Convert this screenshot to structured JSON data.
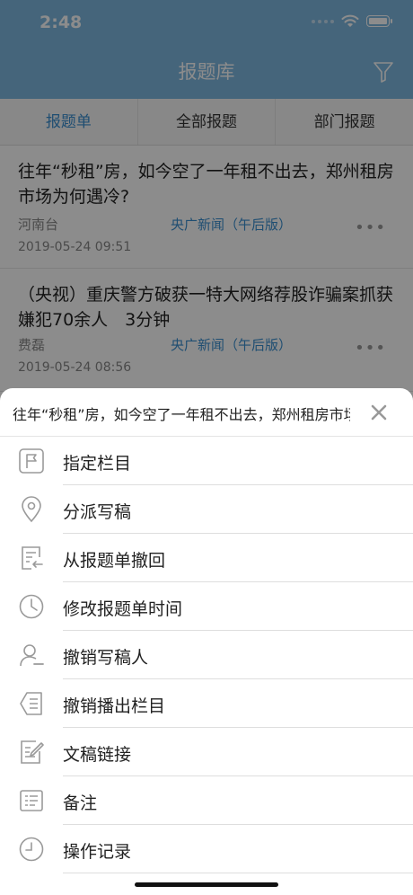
{
  "status_bar": {
    "time": "2:48"
  },
  "nav": {
    "title": "报题库"
  },
  "tabs": [
    {
      "label": "报题单",
      "active": true
    },
    {
      "label": "全部报题",
      "active": false
    },
    {
      "label": "部门报题",
      "active": false
    }
  ],
  "news": [
    {
      "title": "往年“秒租”房，如今空了一年租不出去，郑州租房市场为何遇冷?",
      "author": "河南台",
      "source": "央广新闻（午后版）",
      "date": "2019-05-24 09:51",
      "more": "•••"
    },
    {
      "title": "（央视）重庆警方破获一特大网络荐股诈骗案抓获嫌犯70余人　3分钟",
      "author": "费磊",
      "source": "央广新闻（午后版）",
      "date": "2019-05-24 08:56",
      "more": "•••"
    }
  ],
  "sheet": {
    "title": "往年“秒租”房，如今空了一年租不出去，郑州租房市场为何遇冷?",
    "items": [
      {
        "label": "指定栏目",
        "icon": "flag-icon"
      },
      {
        "label": "分派写稿",
        "icon": "location-pin-icon"
      },
      {
        "label": "从报题单撤回",
        "icon": "withdraw-doc-icon"
      },
      {
        "label": "修改报题单时间",
        "icon": "clock-icon"
      },
      {
        "label": "撤销写稿人",
        "icon": "remove-user-icon"
      },
      {
        "label": "撤销播出栏目",
        "icon": "revoke-column-icon"
      },
      {
        "label": "文稿链接",
        "icon": "doc-link-icon"
      },
      {
        "label": "备注",
        "icon": "note-icon"
      },
      {
        "label": "操作记录",
        "icon": "history-icon"
      }
    ]
  },
  "colors": {
    "nav_bg": "#7fb9e0",
    "accent": "#3a8fd0",
    "icon_gray": "#9a9a9a"
  }
}
